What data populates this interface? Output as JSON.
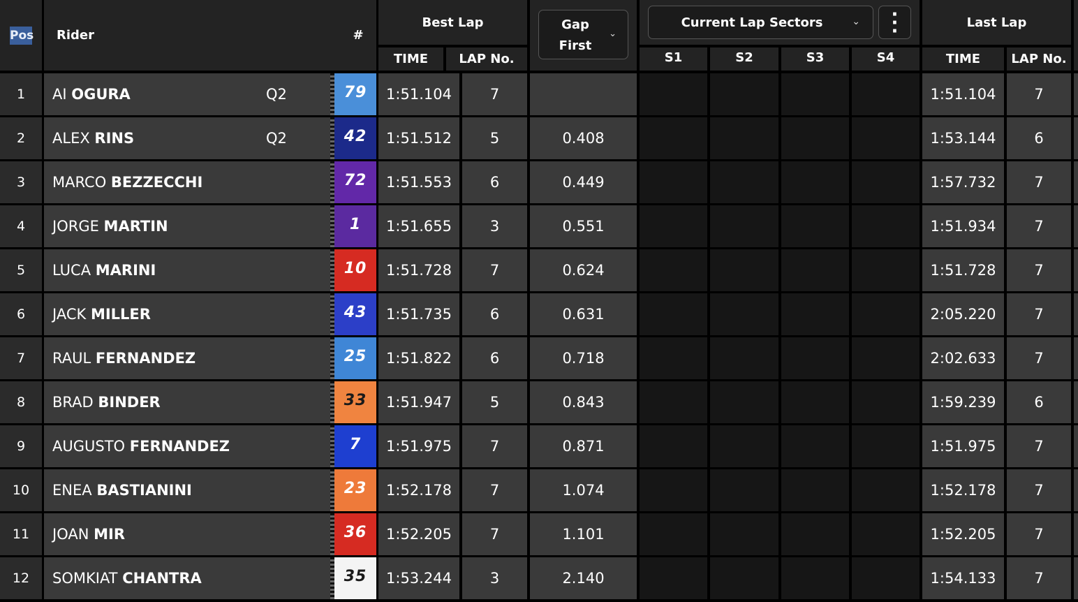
{
  "header": {
    "pos": "Pos",
    "rider": "Rider",
    "number": "#",
    "best_lap": "Best Lap",
    "best_time": "TIME",
    "best_lap_no": "LAP No.",
    "gap_line1": "Gap",
    "gap_line2": "First",
    "sectors_select": "Current Lap Sectors",
    "s1": "S1",
    "s2": "S2",
    "s3": "S3",
    "s4": "S4",
    "last_lap": "Last Lap",
    "last_time": "TIME",
    "last_lap_no": "LAP No."
  },
  "icons": {
    "gap_dropdown": "chevron-down-icon",
    "sectors_dropdown": "chevron-down-icon",
    "more": "more-vertical-icon"
  },
  "rows": [
    {
      "pos": "1",
      "first": "AI",
      "last": "OGURA",
      "q": "Q2",
      "num": "79",
      "color": "#4a8fd9",
      "numtext": "#ffffff",
      "time": "1:51.104",
      "lap": "7",
      "gap": "",
      "ltime": "1:51.104",
      "llap": "7"
    },
    {
      "pos": "2",
      "first": "ALEX",
      "last": "RINS",
      "q": "Q2",
      "num": "42",
      "color": "#1c2a8a",
      "numtext": "#ffffff",
      "time": "1:51.512",
      "lap": "5",
      "gap": "0.408",
      "ltime": "1:53.144",
      "llap": "6"
    },
    {
      "pos": "3",
      "first": "MARCO",
      "last": "BEZZECCHI",
      "q": "",
      "num": "72",
      "color": "#6228a8",
      "numtext": "#ffffff",
      "time": "1:51.553",
      "lap": "6",
      "gap": "0.449",
      "ltime": "1:57.732",
      "llap": "7"
    },
    {
      "pos": "4",
      "first": "JORGE",
      "last": "MARTIN",
      "q": "",
      "num": "1",
      "color": "#5b2aa0",
      "numtext": "#ffffff",
      "time": "1:51.655",
      "lap": "3",
      "gap": "0.551",
      "ltime": "1:51.934",
      "llap": "7"
    },
    {
      "pos": "5",
      "first": "LUCA",
      "last": "MARINI",
      "q": "",
      "num": "10",
      "color": "#d62b22",
      "numtext": "#ffffff",
      "time": "1:51.728",
      "lap": "7",
      "gap": "0.624",
      "ltime": "1:51.728",
      "llap": "7"
    },
    {
      "pos": "6",
      "first": "JACK",
      "last": "MILLER",
      "q": "",
      "num": "43",
      "color": "#2c3fc8",
      "numtext": "#ffffff",
      "time": "1:51.735",
      "lap": "6",
      "gap": "0.631",
      "ltime": "2:05.220",
      "llap": "7"
    },
    {
      "pos": "7",
      "first": "RAUL",
      "last": "FERNANDEZ",
      "q": "",
      "num": "25",
      "color": "#3f86d6",
      "numtext": "#ffffff",
      "time": "1:51.822",
      "lap": "6",
      "gap": "0.718",
      "ltime": "2:02.633",
      "llap": "7"
    },
    {
      "pos": "8",
      "first": "BRAD",
      "last": "BINDER",
      "q": "",
      "num": "33",
      "color": "#f08440",
      "numtext": "#1a1a1a",
      "time": "1:51.947",
      "lap": "5",
      "gap": "0.843",
      "ltime": "1:59.239",
      "llap": "6"
    },
    {
      "pos": "9",
      "first": "AUGUSTO",
      "last": "FERNANDEZ",
      "q": "",
      "num": "7",
      "color": "#1e3fd0",
      "numtext": "#ffffff",
      "time": "1:51.975",
      "lap": "7",
      "gap": "0.871",
      "ltime": "1:51.975",
      "llap": "7"
    },
    {
      "pos": "10",
      "first": "ENEA",
      "last": "BASTIANINI",
      "q": "",
      "num": "23",
      "color": "#ee7a3a",
      "numtext": "#ffffff",
      "time": "1:52.178",
      "lap": "7",
      "gap": "1.074",
      "ltime": "1:52.178",
      "llap": "7"
    },
    {
      "pos": "11",
      "first": "JOAN",
      "last": "MIR",
      "q": "",
      "num": "36",
      "color": "#d62b22",
      "numtext": "#ffffff",
      "time": "1:52.205",
      "lap": "7",
      "gap": "1.101",
      "ltime": "1:52.205",
      "llap": "7"
    },
    {
      "pos": "12",
      "first": "SOMKIAT",
      "last": "CHANTRA",
      "q": "",
      "num": "35",
      "color": "#f4f4f4",
      "numtext": "#1a1a1a",
      "time": "1:53.244",
      "lap": "3",
      "gap": "2.140",
      "ltime": "1:54.133",
      "llap": "7"
    }
  ]
}
